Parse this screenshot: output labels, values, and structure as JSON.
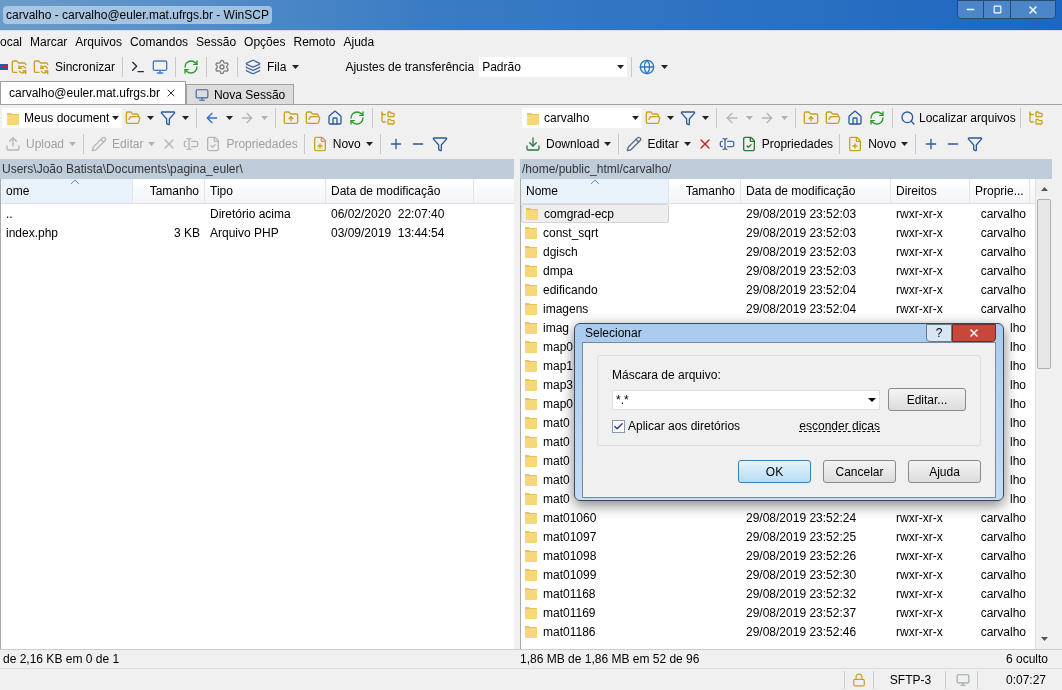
{
  "window": {
    "title": "carvalho - carvalho@euler.mat.ufrgs.br - WinSCP"
  },
  "menu": [
    "ocal",
    "Marcar",
    "Arquivos",
    "Comandos",
    "Sessão",
    "Opções",
    "Remoto",
    "Ajuda"
  ],
  "toolbar": {
    "sync": "Sincronizar",
    "queue": "Fila",
    "transfer_label": "Ajustes de transferência",
    "transfer_value": "Padrão"
  },
  "tabs": [
    {
      "label": "carvalho@euler.mat.ufrgs.br",
      "selected": true
    },
    {
      "label": "Nova Sessão",
      "selected": false
    }
  ],
  "left_panel": {
    "location": "Meus document",
    "back_disabled": false,
    "forward_disabled": true,
    "actions": [
      {
        "label": "Upload",
        "disabled": true
      },
      {
        "label": "Editar",
        "disabled": true
      },
      {
        "label": "Propriedades",
        "disabled": true
      },
      {
        "label": "Novo",
        "disabled": false
      }
    ],
    "delete_disabled": true,
    "rename_disabled": true,
    "path": "Users\\João Batista\\Documents\\pagina_euler\\",
    "columns": [
      "ome",
      "Tamanho",
      "Tipo",
      "Data de modificação"
    ],
    "rows": [
      {
        "name": "..",
        "size": "",
        "type": "Diretório acima",
        "modified": "06/02/2020  22:07:40"
      },
      {
        "name": "index.php",
        "size": "3 KB",
        "type": "Arquivo PHP",
        "modified": "03/09/2019  13:44:54"
      }
    ],
    "status": "de 2,16 KB em 0 de 1"
  },
  "right_panel": {
    "location": "carvalho",
    "back_disabled": true,
    "forward_disabled": true,
    "find": "Localizar arquivos",
    "actions": [
      {
        "label": "Download",
        "disabled": false
      },
      {
        "label": "Editar",
        "disabled": false
      },
      {
        "label": "Propriedades",
        "disabled": false
      },
      {
        "label": "Novo",
        "disabled": false
      }
    ],
    "delete_disabled": false,
    "rename_disabled": false,
    "path": "/home/public_html/carvalho/",
    "columns": [
      "Nome",
      "Tamanho",
      "Data de modificação",
      "Direitos",
      "Proprie..."
    ],
    "rows": [
      {
        "name": "comgrad-ecp",
        "modified": "29/08/2019 23:52:03",
        "rights": "rwxr-xr-x",
        "owner": "carvalho",
        "selected": true
      },
      {
        "name": "const_sqrt",
        "modified": "29/08/2019 23:52:03",
        "rights": "rwxr-xr-x",
        "owner": "carvalho",
        "selected": false
      },
      {
        "name": "dgisch",
        "modified": "29/08/2019 23:52:03",
        "rights": "rwxr-xr-x",
        "owner": "carvalho",
        "selected": false
      },
      {
        "name": "dmpa",
        "modified": "29/08/2019 23:52:03",
        "rights": "rwxr-xr-x",
        "owner": "carvalho",
        "selected": false
      },
      {
        "name": "edificando",
        "modified": "29/08/2019 23:52:04",
        "rights": "rwxr-xr-x",
        "owner": "carvalho",
        "selected": false
      },
      {
        "name": "imagens",
        "modified": "29/08/2019 23:52:04",
        "rights": "rwxr-xr-x",
        "owner": "carvalho",
        "selected": false
      },
      {
        "name": "imag",
        "owner": "lho",
        "selected": false
      },
      {
        "name": "map0",
        "owner": "lho",
        "selected": false
      },
      {
        "name": "map1",
        "owner": "lho",
        "selected": false
      },
      {
        "name": "map3",
        "owner": "lho",
        "selected": false
      },
      {
        "name": "map0",
        "owner": "lho",
        "selected": false
      },
      {
        "name": "mat0",
        "owner": "lho",
        "selected": false
      },
      {
        "name": "mat0",
        "owner": "lho",
        "selected": false
      },
      {
        "name": "mat0",
        "owner": "lho",
        "selected": false
      },
      {
        "name": "mat0",
        "owner": "lho",
        "selected": false
      },
      {
        "name": "mat0",
        "owner": "lho",
        "selected": false
      },
      {
        "name": "mat01060",
        "modified": "29/08/2019 23:52:24",
        "rights": "rwxr-xr-x",
        "owner": "carvalho",
        "selected": false
      },
      {
        "name": "mat01097",
        "modified": "29/08/2019 23:52:25",
        "rights": "rwxr-xr-x",
        "owner": "carvalho",
        "selected": false
      },
      {
        "name": "mat01098",
        "modified": "29/08/2019 23:52:26",
        "rights": "rwxr-xr-x",
        "owner": "carvalho",
        "selected": false
      },
      {
        "name": "mat01099",
        "modified": "29/08/2019 23:52:30",
        "rights": "rwxr-xr-x",
        "owner": "carvalho",
        "selected": false
      },
      {
        "name": "mat01168",
        "modified": "29/08/2019 23:52:32",
        "rights": "rwxr-xr-x",
        "owner": "carvalho",
        "selected": false
      },
      {
        "name": "mat01169",
        "modified": "29/08/2019 23:52:37",
        "rights": "rwxr-xr-x",
        "owner": "carvalho",
        "selected": false
      },
      {
        "name": "mat01186",
        "modified": "29/08/2019 23:52:46",
        "rights": "rwxr-xr-x",
        "owner": "carvalho",
        "selected": false
      }
    ],
    "status": "1,86 MB de 1,86 MB em 52 de 96",
    "hidden": "6 oculto"
  },
  "status_bar": {
    "protocol": "SFTP-3",
    "elapsed": "0:07:27"
  },
  "dialog": {
    "title": "Selecionar",
    "help": "?",
    "mask_label": "Máscara de arquivo:",
    "mask_value": "*.*",
    "edit": "Editar...",
    "apply_dirs": {
      "label": "Aplicar aos diretórios",
      "checked": true
    },
    "hide_tips": "esconder dicas",
    "buttons": [
      {
        "label": "OK",
        "default": true
      },
      {
        "label": "Cancelar",
        "default": false
      },
      {
        "label": "Ajuda",
        "default": false
      }
    ]
  }
}
